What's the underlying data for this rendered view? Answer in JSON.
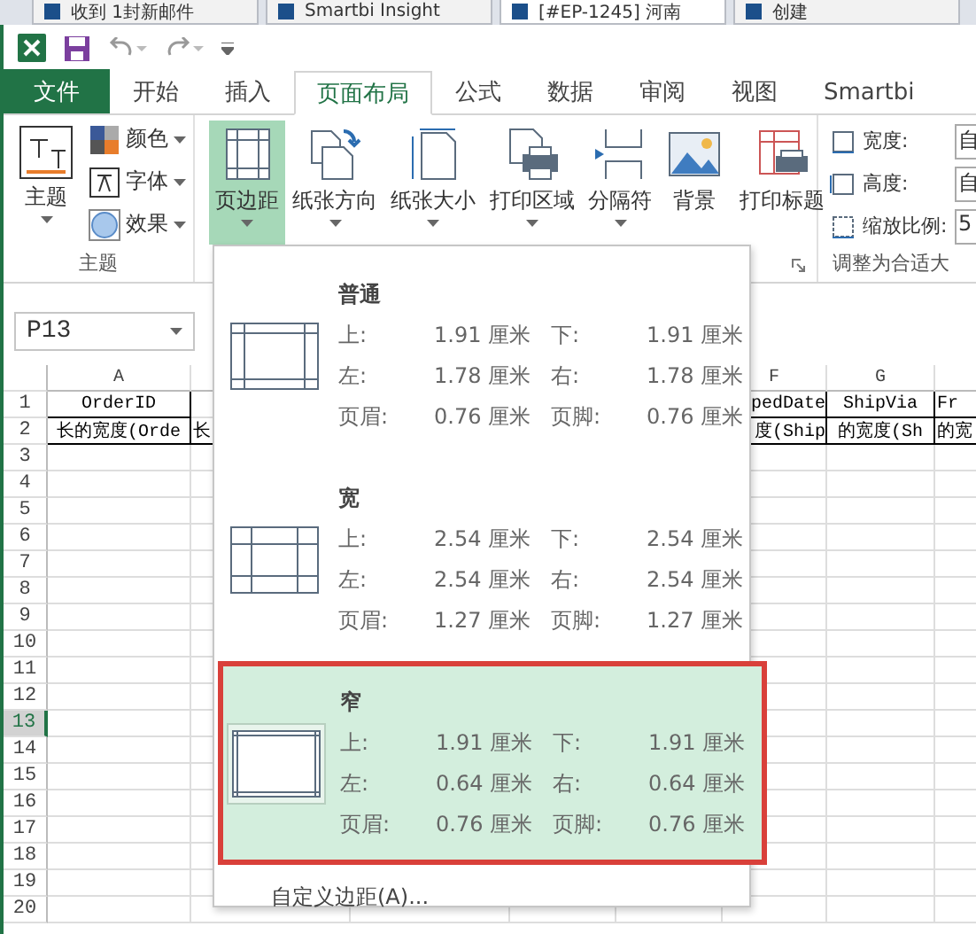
{
  "browser_tabs": [
    {
      "title": "收到 1封新邮件",
      "selected": false
    },
    {
      "title": "Smartbi Insight",
      "selected": false
    },
    {
      "title": "[#EP-1245] 河南",
      "selected": true
    },
    {
      "title": "创建",
      "selected": false
    }
  ],
  "ribbon_tabs": [
    {
      "label": "文件",
      "kind": "file",
      "selected": false
    },
    {
      "label": "开始",
      "kind": "tab",
      "selected": false
    },
    {
      "label": "插入",
      "kind": "tab",
      "selected": false
    },
    {
      "label": "页面布局",
      "kind": "tab",
      "selected": true
    },
    {
      "label": "公式",
      "kind": "tab",
      "selected": false
    },
    {
      "label": "数据",
      "kind": "tab",
      "selected": false
    },
    {
      "label": "审阅",
      "kind": "tab",
      "selected": false
    },
    {
      "label": "视图",
      "kind": "tab",
      "selected": false
    },
    {
      "label": "Smartbi",
      "kind": "tab",
      "selected": false
    }
  ],
  "theme_group": {
    "label": "主题",
    "big_button": "主题",
    "small_buttons": [
      {
        "label": "颜色",
        "kind": "colors"
      },
      {
        "label": "字体",
        "kind": "fonts"
      },
      {
        "label": "效果",
        "kind": "effects"
      }
    ]
  },
  "page_setup_buttons": [
    {
      "label": "页边距",
      "kind": "margins",
      "selected": true,
      "has_menu": true
    },
    {
      "label": "纸张方向",
      "kind": "orientation",
      "selected": false,
      "has_menu": true
    },
    {
      "label": "纸张大小",
      "kind": "size",
      "selected": false,
      "has_menu": true
    },
    {
      "label": "打印区域",
      "kind": "print_area",
      "selected": false,
      "has_menu": true
    },
    {
      "label": "分隔符",
      "kind": "breaks",
      "selected": false,
      "has_menu": true
    },
    {
      "label": "背景",
      "kind": "background",
      "selected": false,
      "has_menu": false
    },
    {
      "label": "打印标题",
      "kind": "print_titles",
      "selected": false,
      "has_menu": false
    }
  ],
  "scale_group": {
    "label": "调整为合适大",
    "fields": [
      {
        "label": "宽度:",
        "kind": "width",
        "value": "自"
      },
      {
        "label": "高度:",
        "kind": "height",
        "value": "自"
      },
      {
        "label": "缩放比例:",
        "kind": "scale",
        "value": "5"
      }
    ]
  },
  "name_box": "P13",
  "columns": [
    {
      "header": "A"
    },
    {},
    {},
    {},
    {},
    {
      "header": "F"
    },
    {
      "header": "G"
    },
    {}
  ],
  "rows": [
    {
      "number": "1",
      "selected": false,
      "cells": [
        "OrderID",
        null,
        null,
        null,
        null,
        "pedDate",
        "ShipVia",
        "Fr"
      ]
    },
    {
      "number": "2",
      "selected": false,
      "cells": [
        "长的宽度(Orde",
        "长",
        null,
        null,
        null,
        "度(Ship",
        "的宽度(Sh",
        "的宽"
      ]
    },
    {
      "number": "3",
      "selected": false
    },
    {
      "number": "4",
      "selected": false
    },
    {
      "number": "5",
      "selected": false
    },
    {
      "number": "6",
      "selected": false
    },
    {
      "number": "7",
      "selected": false
    },
    {
      "number": "8",
      "selected": false
    },
    {
      "number": "9",
      "selected": false
    },
    {
      "number": "10",
      "selected": false
    },
    {
      "number": "11",
      "selected": false
    },
    {
      "number": "12",
      "selected": false
    },
    {
      "number": "13",
      "selected": true
    },
    {
      "number": "14",
      "selected": false
    },
    {
      "number": "15",
      "selected": false
    },
    {
      "number": "16",
      "selected": false
    },
    {
      "number": "17",
      "selected": false
    },
    {
      "number": "18",
      "selected": false
    },
    {
      "number": "19",
      "selected": false
    },
    {
      "number": "20",
      "selected": false
    }
  ],
  "margins_menu": {
    "presets": [
      {
        "name": "普通",
        "kind": "normal",
        "selected": false,
        "values": [
          [
            "上:",
            "1.91 厘米",
            "下:",
            "1.91 厘米"
          ],
          [
            "左:",
            "1.78 厘米",
            "右:",
            "1.78 厘米"
          ],
          [
            "页眉:",
            "0.76 厘米",
            "页脚:",
            "0.76 厘米"
          ]
        ]
      },
      {
        "name": "宽",
        "kind": "wide",
        "selected": false,
        "values": [
          [
            "上:",
            "2.54 厘米",
            "下:",
            "2.54 厘米"
          ],
          [
            "左:",
            "2.54 厘米",
            "右:",
            "2.54 厘米"
          ],
          [
            "页眉:",
            "1.27 厘米",
            "页脚:",
            "1.27 厘米"
          ]
        ]
      },
      {
        "name": "窄",
        "kind": "narrow",
        "selected": true,
        "values": [
          [
            "上:",
            "1.91 厘米",
            "下:",
            "1.91 厘米"
          ],
          [
            "左:",
            "0.64 厘米",
            "右:",
            "0.64 厘米"
          ],
          [
            "页眉:",
            "0.76 厘米",
            "页脚:",
            "0.76 厘米"
          ]
        ]
      }
    ],
    "custom": "自定义边距(A)..."
  }
}
